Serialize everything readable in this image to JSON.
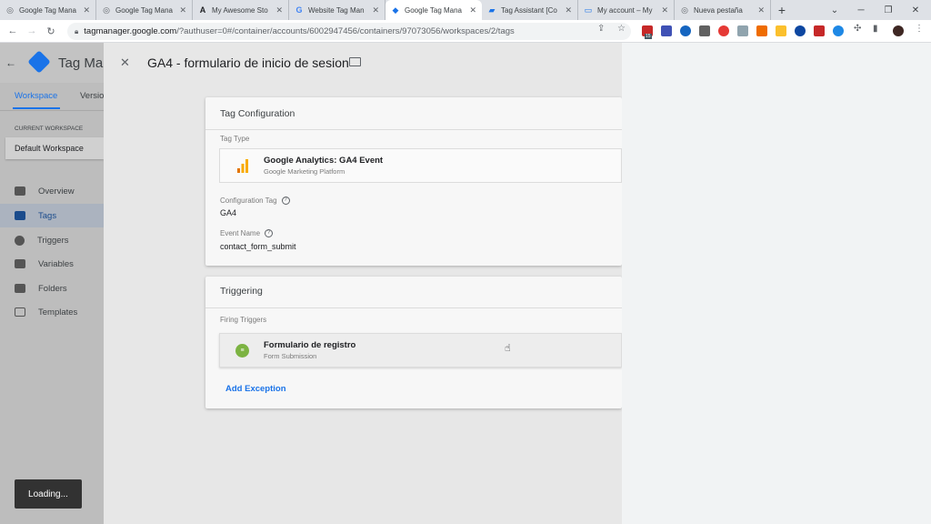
{
  "browser": {
    "tabs": [
      {
        "title": "Google Tag Mana",
        "icon": "globe-icon"
      },
      {
        "title": "Google Tag Mana",
        "icon": "globe-icon"
      },
      {
        "title": "My Awesome Sto",
        "icon": "shop-icon"
      },
      {
        "title": "Website Tag Man",
        "icon": "google-icon"
      },
      {
        "title": "Google Tag Mana",
        "icon": "gtm-icon"
      },
      {
        "title": "Tag Assistant [Co",
        "icon": "tag-assistant-icon"
      },
      {
        "title": "My account – My",
        "icon": "account-icon"
      },
      {
        "title": "Nueva pestaña",
        "icon": "globe-icon"
      }
    ],
    "new_tab": "+",
    "url_host": "tagmanager.google.com",
    "url_path": "/?authuser=0#/container/accounts/6002947456/containers/97073056/workspaces/2/tags",
    "extension_badge": "15"
  },
  "gtm": {
    "app_title": "Tag Mar",
    "nav_tabs": [
      "Workspace",
      "Versio"
    ],
    "current_workspace_label": "CURRENT WORKSPACE",
    "workspace_name": "Default Workspace",
    "nav_items": [
      "Overview",
      "Tags",
      "Triggers",
      "Variables",
      "Folders",
      "Templates"
    ],
    "loading_text": "Loading..."
  },
  "dialog": {
    "title": "GA4 - formulario de inicio de sesion",
    "tag_config": {
      "heading": "Tag Configuration",
      "type_label": "Tag Type",
      "type_name": "Google Analytics: GA4 Event",
      "type_sub": "Google Marketing Platform",
      "config_tag_label": "Configuration Tag",
      "config_tag_value": "GA4",
      "event_name_label": "Event Name",
      "event_name_value": "contact_form_submit"
    },
    "triggering": {
      "heading": "Triggering",
      "firing_label": "Firing Triggers",
      "trigger_name": "Formulario de registro",
      "trigger_type": "Form Submission",
      "add_exception": "Add Exception"
    }
  },
  "colors": {
    "accent_blue": "#1a73e8",
    "trigger_green": "#7cb342",
    "ga_orange": "#f9ab00"
  }
}
